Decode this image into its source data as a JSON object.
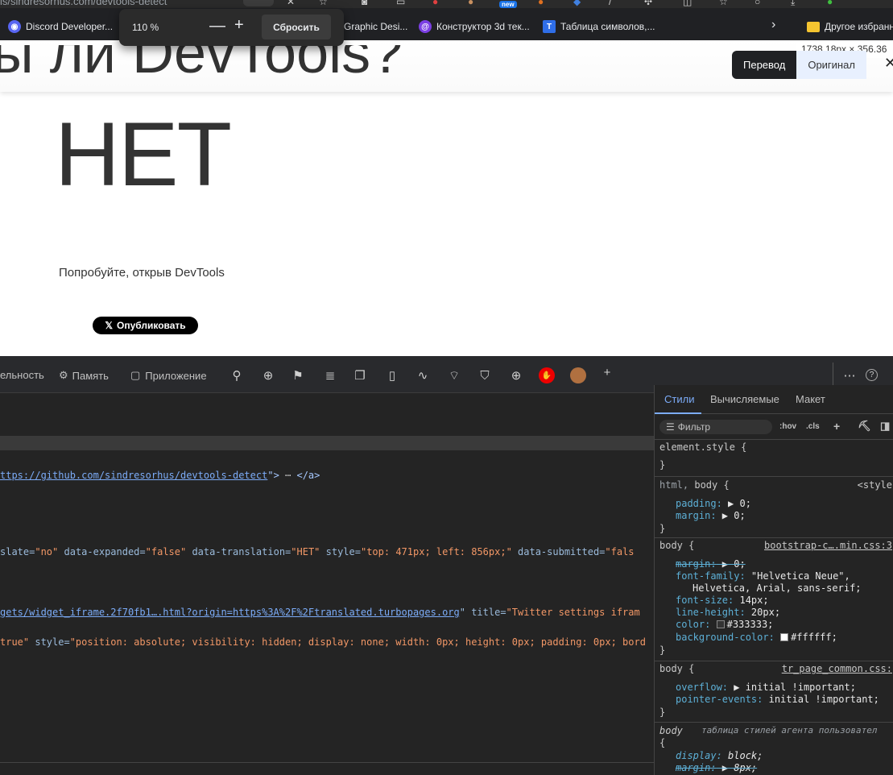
{
  "browser": {
    "address_fragment": "is/sindresorhus.com/devtools-detect",
    "new_badge": "new",
    "bookmarks": [
      {
        "label": "Discord Developer..."
      },
      {
        "label": "Graphic Desi..."
      },
      {
        "label": "Конструктор 3d тек..."
      },
      {
        "label": "Таблица символов,..."
      },
      {
        "label": "Другое избранн"
      }
    ]
  },
  "zoom_popup": {
    "value": "110 %",
    "minus": "—",
    "plus": "+",
    "reset_label": "Сбросить"
  },
  "page": {
    "title_partial": "ы ли DevTools?",
    "answer": "НЕТ",
    "hint": "Попробуйте, открыв DevTools",
    "tweet_label": "Опубликовать",
    "dimensions": "1738.18px × 356.36",
    "translate_active": "Перевод",
    "translate_original": "Оригинал",
    "close": "✕"
  },
  "devtools": {
    "tabs": [
      {
        "label": "ельность"
      },
      {
        "label": "Память"
      },
      {
        "label": "Приложение"
      }
    ],
    "more": "⋯",
    "help": "?",
    "plus": "+",
    "code_lines": [
      {
        "parts": [
          [
            "c-link",
            "ttps://github.com/sindresorhus/devtools-detect"
          ],
          [
            "c-tag",
            "\">"
          ],
          [
            "c-plain",
            " ⋯ "
          ],
          [
            "c-tag",
            "</a>"
          ]
        ]
      },
      {
        "parts": [
          [
            "c-attr",
            "slate="
          ],
          [
            "c-val",
            "\"no\""
          ],
          [
            "c-attr",
            " data-expanded="
          ],
          [
            "c-val",
            "\"false\""
          ],
          [
            "c-attr",
            " data-translation="
          ],
          [
            "c-val",
            "\"НЕТ\""
          ],
          [
            "c-attr",
            " style="
          ],
          [
            "c-val",
            "\"top: 471px; left: 856px;\""
          ],
          [
            "c-attr",
            " data-submitted="
          ],
          [
            "c-val",
            "\"fals"
          ]
        ]
      },
      {
        "parts": [
          [
            "c-link",
            "gets/widget_iframe.2f70fb1….html?origin=https%3A%2F%2Ftranslated.turbopages.org"
          ],
          [
            "c-attr",
            "\" title="
          ],
          [
            "c-val",
            "\"Twitter settings ifram"
          ]
        ]
      },
      {
        "parts": [
          [
            "c-val",
            "true\""
          ],
          [
            "c-attr",
            " style="
          ],
          [
            "c-val",
            "\"position: absolute; visibility: hidden; display: none; width: 0px; height: 0px; padding: 0px; bord"
          ]
        ]
      }
    ],
    "styles": {
      "tabs": [
        "Стили",
        "Вычисляемые",
        "Макет"
      ],
      "filter_placeholder": "Фильтр",
      "hov": ":hov",
      "cls": ".cls",
      "rules": {
        "element_style": {
          "selector": "element.style {",
          "close": "}"
        },
        "html_body": {
          "selector_html": "html,",
          "selector_body": " body {",
          "source": "<style",
          "props": [
            [
              "padding:",
              " ▶ 0;"
            ],
            [
              "margin:",
              " ▶ 0;"
            ]
          ],
          "close": "}"
        },
        "body_bootstrap": {
          "selector": "body {",
          "source": "bootstrap-c….min.css:3",
          "margin": [
            "margin:",
            " ▶ 0;"
          ],
          "font_family": [
            "font-family:",
            " \"Helvetica Neue\","
          ],
          "font_family_cont": "Helvetica, Arial, sans-serif;",
          "font_size": [
            "font-size:",
            " 14px;"
          ],
          "line_height": [
            "line-height:",
            " 20px;"
          ],
          "color": [
            "color:",
            "#333333;"
          ],
          "bg": [
            "background-color:",
            "#ffffff;"
          ],
          "close": "}"
        },
        "body_tr": {
          "selector": "body {",
          "source": "tr_page_common.css:",
          "overflow": [
            "overflow:",
            " ▶ initial !important;"
          ],
          "pointer": [
            "pointer-events:",
            " initial !important;"
          ],
          "close": "}"
        },
        "body_ua": {
          "selector": "body",
          "source": "таблица стилей агента пользовател",
          "open": "{",
          "display": [
            "display:",
            " block;"
          ],
          "margin": [
            "margin:",
            " ▶ 8px;"
          ]
        }
      }
    }
  }
}
